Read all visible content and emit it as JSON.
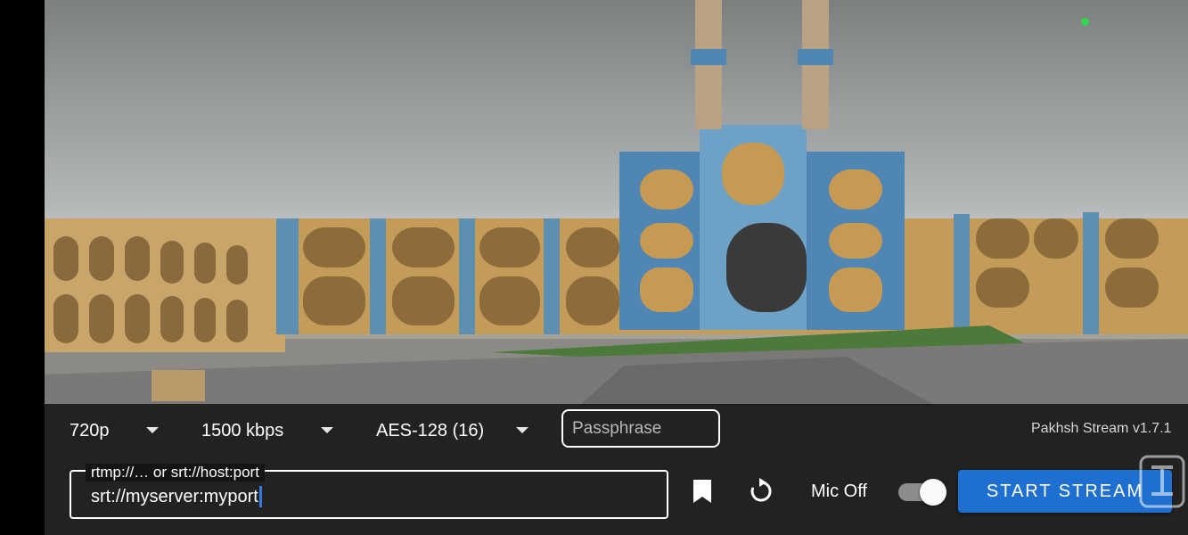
{
  "preview": {
    "scene": "camera-preview"
  },
  "settings": {
    "resolution": "720p",
    "bitrate": "1500 kbps",
    "encryption": "AES-128 (16)",
    "passphrase_placeholder": "Passphrase",
    "version": "Pakhsh Stream v1.7.1"
  },
  "url": {
    "label": "rtmp://… or srt://host:port",
    "value": "srt://myserver:myport"
  },
  "actions": {
    "bookmark_icon": "bookmark-icon",
    "reset_icon": "refresh-icon",
    "mic_label": "Mic Off",
    "mic_toggle_on": true,
    "start_label": "START STREAM"
  },
  "colors": {
    "accent": "#1f6fd1",
    "recording_dot": "#2fd64a",
    "cursor": "#2f7be6"
  }
}
